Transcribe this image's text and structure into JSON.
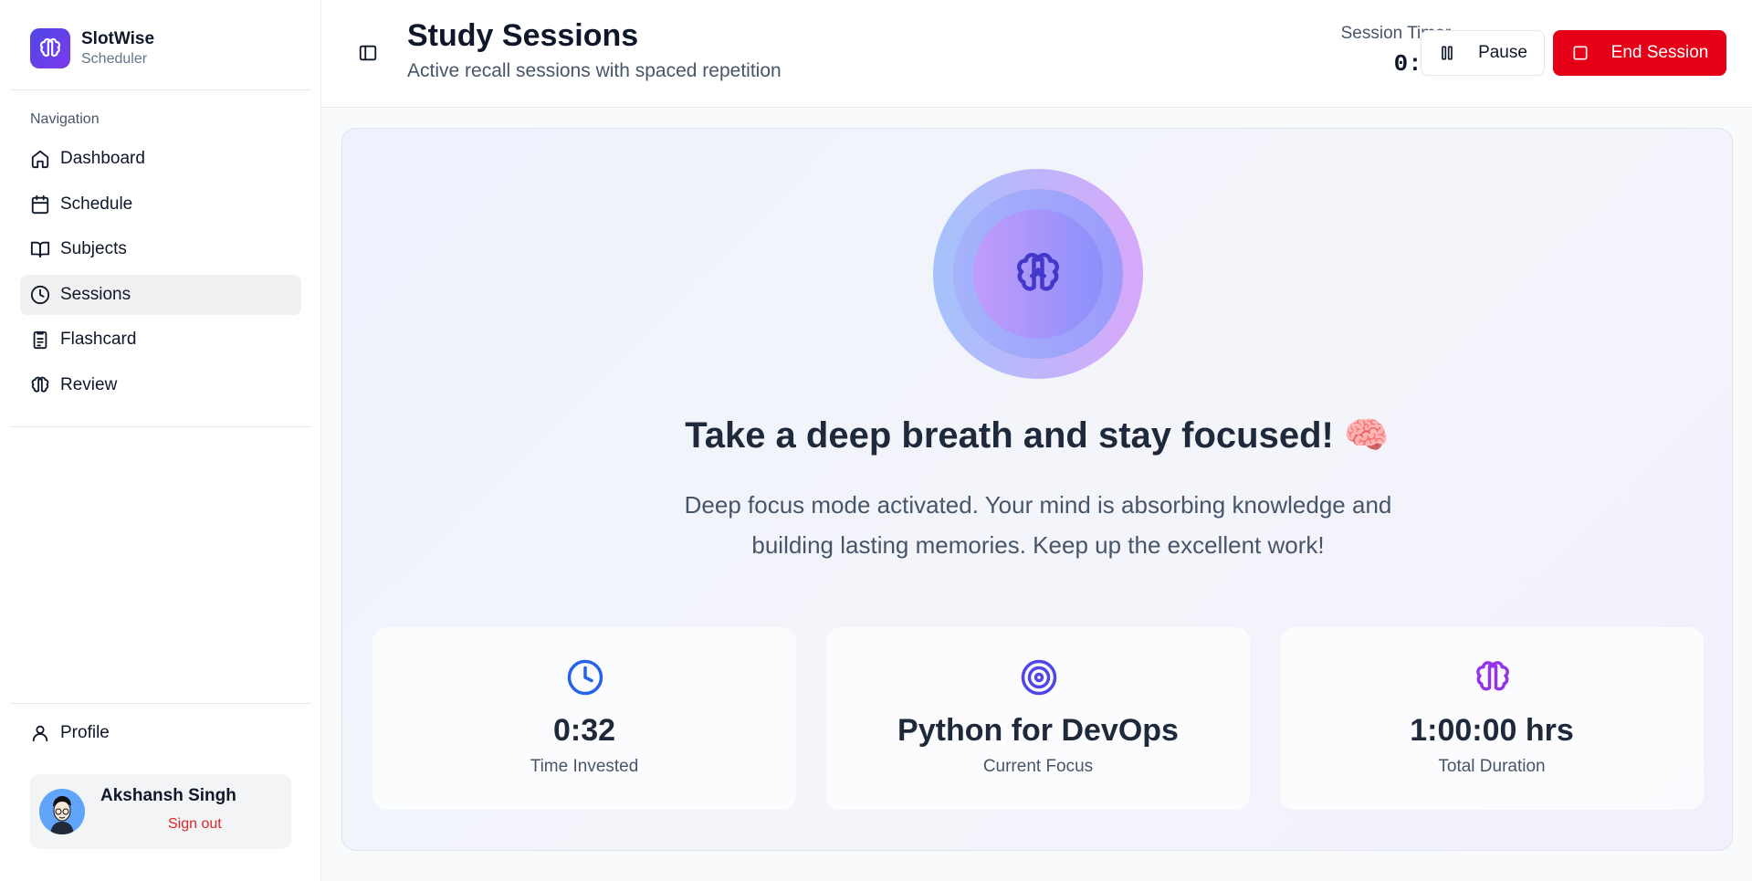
{
  "brand": {
    "name": "SlotWise",
    "subtitle": "Scheduler"
  },
  "sidebar": {
    "nav_label": "Navigation",
    "items": [
      {
        "label": "Dashboard",
        "icon": "home-icon"
      },
      {
        "label": "Schedule",
        "icon": "calendar-icon"
      },
      {
        "label": "Subjects",
        "icon": "book-icon"
      },
      {
        "label": "Sessions",
        "icon": "clock-icon",
        "active": true
      },
      {
        "label": "Flashcard",
        "icon": "clipboard-icon"
      },
      {
        "label": "Review",
        "icon": "brain-icon"
      }
    ],
    "profile_label": "Profile",
    "user": {
      "name": "Akshansh Singh",
      "signout": "Sign out"
    }
  },
  "header": {
    "title": "Study Sessions",
    "subtitle": "Active recall sessions with spaced repetition",
    "timer_label": "Session Timer",
    "timer_value": "0:32",
    "pause_label": "Pause",
    "end_label": "End Session"
  },
  "focus": {
    "headline": "Take a deep breath and stay focused! 🧠",
    "description": "Deep focus mode activated. Your mind is absorbing knowledge and building lasting memories. Keep up the excellent work!",
    "stats": [
      {
        "value": "0:32",
        "label": "Time Invested",
        "icon": "clock-icon",
        "color": "#2563eb"
      },
      {
        "value": "Python for DevOps",
        "label": "Current Focus",
        "icon": "target-icon",
        "color": "#4f46e5"
      },
      {
        "value": "1:00:00 hrs",
        "label": "Total Duration",
        "icon": "brain-icon",
        "color": "#9333ea"
      }
    ]
  },
  "colors": {
    "accent": "#e60017",
    "brand": "#6d28d9"
  }
}
